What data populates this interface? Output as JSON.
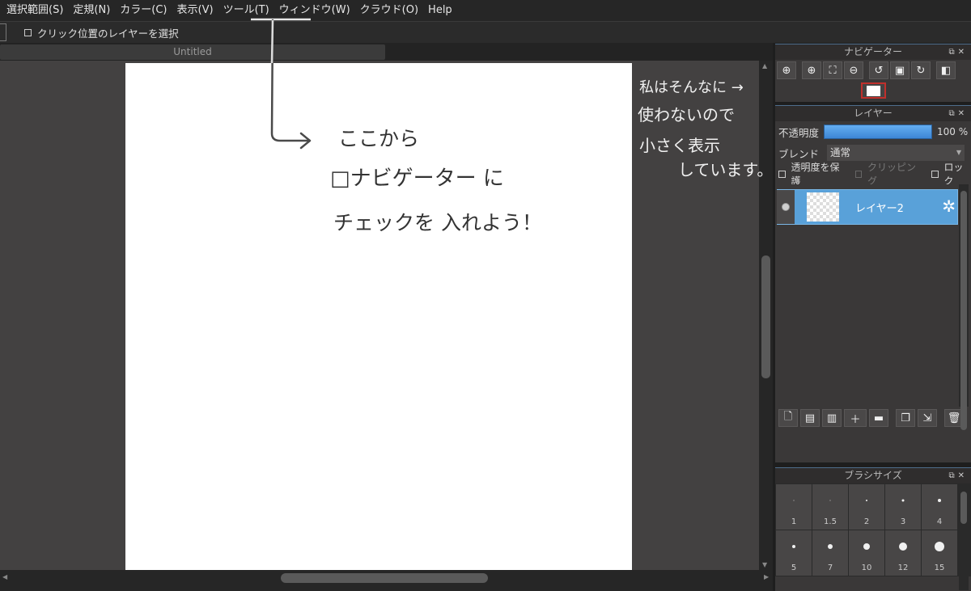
{
  "menu": {
    "items": [
      "選択範囲(S)",
      "定規(N)",
      "カラー(C)",
      "表示(V)",
      "ツール(T)",
      "ウィンドウ(W)",
      "クラウド(O)",
      "Help"
    ]
  },
  "options": {
    "select_layer_on_click": "クリック位置のレイヤーを選択"
  },
  "document": {
    "tab_title": "Untitled"
  },
  "annotations": {
    "canvas_line1": "ここから",
    "canvas_line2": "□ナビゲーター に",
    "canvas_line3": "チェックを 入れよう！",
    "side_line1": "私はそんなに →",
    "side_line2": "使わないので",
    "side_line3": "小さく表示",
    "side_line4": "しています。"
  },
  "navigator": {
    "title": "ナビゲーター",
    "tools": [
      "zoom-fit-icon",
      "zoom-in-icon",
      "fit-window-icon",
      "zoom-out-icon",
      "rotate-left-icon",
      "reset-view-icon",
      "rotate-right-icon",
      "flip-icon"
    ]
  },
  "layers_panel": {
    "title": "レイヤー",
    "opacity_label": "不透明度",
    "opacity_value": "100 %",
    "opacity": 1.0,
    "blend_label": "ブレンド",
    "blend_value": "通常",
    "protect_alpha": "透明度を保護",
    "clipping": "クリッピング",
    "lock": "ロック",
    "layers": [
      {
        "name": "レイヤー2",
        "visible": true,
        "selected": true
      }
    ],
    "tools": [
      "new-layer-icon",
      "new-halftone-layer-icon",
      "new-1bit-layer-icon",
      "add-layer-menu-icon",
      "new-folder-icon",
      "duplicate-layer-icon",
      "merge-down-icon",
      "delete-layer-icon"
    ]
  },
  "brush_size": {
    "title": "ブラシサイズ",
    "sizes": [
      "1",
      "1.5",
      "2",
      "3",
      "4",
      "5",
      "7",
      "10",
      "12",
      "15"
    ]
  },
  "colors": {
    "accent": "#59a1d9",
    "highlight_red": "#c0302c"
  }
}
